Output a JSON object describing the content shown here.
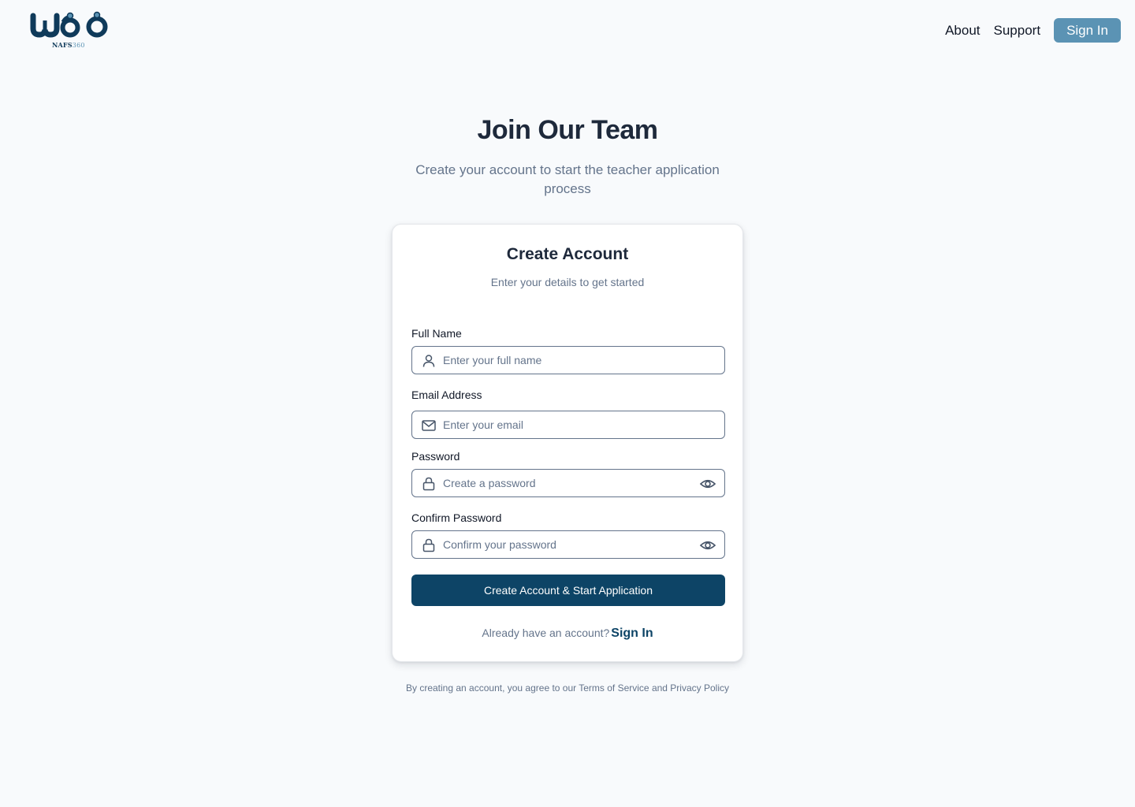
{
  "brand": {
    "logo_name": "NAFS",
    "logo_suffix": "360"
  },
  "nav": {
    "about": "About",
    "support": "Support",
    "sign_in": "Sign In"
  },
  "hero": {
    "title": "Join Our Team",
    "subtitle": "Create your account to start the teacher application process"
  },
  "card": {
    "title": "Create Account",
    "subtitle": "Enter your details to get started",
    "fields": [
      {
        "label": "Full Name",
        "placeholder": "Enter your full name",
        "value": "",
        "icon": "user-icon"
      },
      {
        "label": "Email Address",
        "placeholder": "Enter your email",
        "value": "",
        "icon": "mail-icon"
      },
      {
        "label": "Password",
        "placeholder": "Create a password",
        "value": "",
        "icon": "lock-icon"
      },
      {
        "label": "Confirm Password",
        "placeholder": "Confirm your password",
        "value": "",
        "icon": "lock-icon"
      }
    ],
    "submit_label": "Create Account & Start Application",
    "signin_prompt": "Already have an account?",
    "signin_link": "Sign In"
  },
  "footer": {
    "terms": "By creating an account, you agree to our Terms of Service and Privacy Policy"
  },
  "colors": {
    "background": "#f8fafc",
    "primary": "#0d4466",
    "accent": "#5b93b4",
    "text": "#1e293b",
    "muted": "#64748b"
  }
}
